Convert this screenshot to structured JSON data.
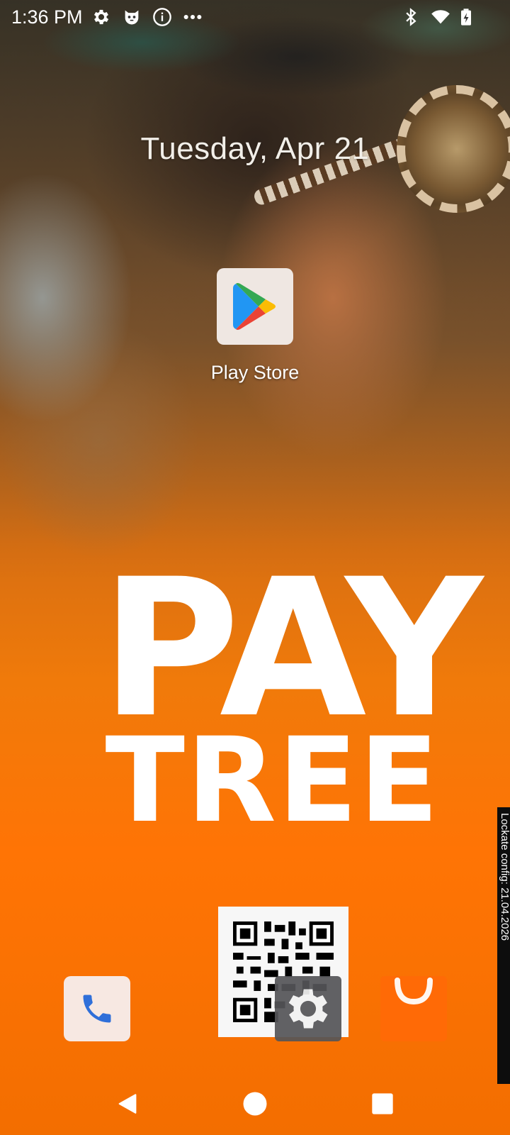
{
  "status_bar": {
    "time": "1:36 PM",
    "left_icons": [
      "gear-icon",
      "cat-face-icon",
      "info-icon",
      "more-dots-icon"
    ],
    "right_icons": [
      "bluetooth-icon",
      "wifi-icon",
      "battery-charging-icon"
    ]
  },
  "home": {
    "date": "Tuesday, Apr 21",
    "apps": [
      {
        "label": "Play Store",
        "icon": "play-store-icon"
      }
    ]
  },
  "wallpaper": {
    "brand_line1": "PAY",
    "brand_line2": "TREE",
    "accent_color": "#ff7405"
  },
  "side_banner": {
    "text": "Lockate config: 21.04.2026"
  },
  "dock": {
    "apps": [
      {
        "icon": "phone-icon"
      },
      {
        "icon": "qr-code-icon"
      },
      {
        "icon": "settings-gear-icon"
      },
      {
        "icon": "shopping-bag-icon"
      }
    ]
  },
  "nav_bar": {
    "buttons": [
      "back-icon",
      "home-icon",
      "recents-icon"
    ]
  }
}
